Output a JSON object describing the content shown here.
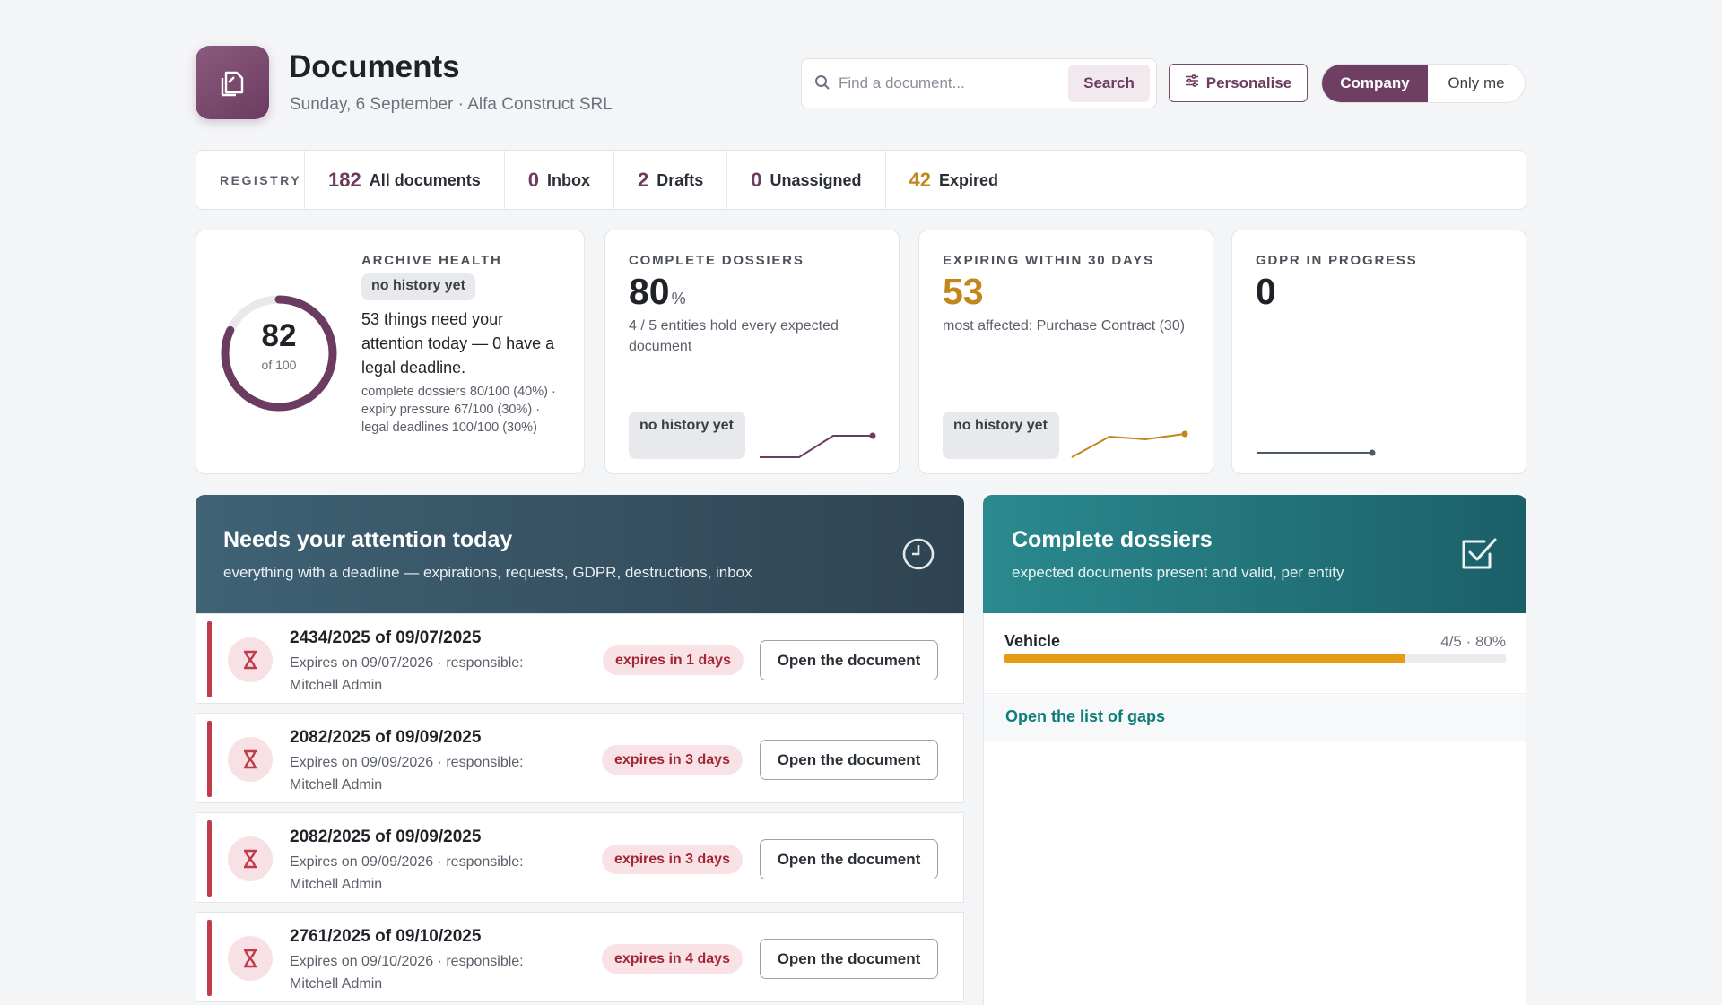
{
  "header": {
    "title": "Documents",
    "subtitle": "Sunday, 6 September · Alfa Construct SRL",
    "search_placeholder": "Find a document...",
    "search_button": "Search",
    "personalise_button": "Personalise",
    "scope_options": [
      "Company",
      "Only me"
    ],
    "scope_selected": "Company"
  },
  "registry": {
    "label": "REGISTRY",
    "items": [
      {
        "count": "182",
        "label": "All documents"
      },
      {
        "count": "0",
        "label": "Inbox"
      },
      {
        "count": "2",
        "label": "Drafts"
      },
      {
        "count": "0",
        "label": "Unassigned"
      },
      {
        "count": "42",
        "label": "Expired"
      }
    ]
  },
  "archive_health": {
    "label": "ARCHIVE HEALTH",
    "badge": "no history yet",
    "score": "82",
    "score_max_label": "of 100",
    "score_fraction": 0.82,
    "headline": "53 things need your attention today — 0 have a legal deadline.",
    "breakdown": "complete dossiers 80/100 (40%) · expiry pressure 67/100 (30%) · legal deadlines 100/100 (30%)"
  },
  "complete_dossiers_kpi": {
    "label": "COMPLETE DOSSIERS",
    "value": "80",
    "unit": "%",
    "description": "4 / 5 entities hold every expected document",
    "badge": "no history yet",
    "sparkline_color": "#6b3b60"
  },
  "expiring_kpi": {
    "label": "EXPIRING WITHIN 30 DAYS",
    "value": "53",
    "description": "most affected: Purchase Contract (30)",
    "badge": "no history yet",
    "value_color": "#c2861b",
    "sparkline_color": "#c2861b"
  },
  "gdpr_kpi": {
    "label": "GDPR IN PROGRESS",
    "value": "0",
    "sparkline_color": "#4a5a6a"
  },
  "attention": {
    "title": "Needs your attention today",
    "subtitle": "everything with a deadline — expirations, requests, GDPR, destructions, inbox",
    "icon": "clock-icon",
    "rows": [
      {
        "title": "2434/2025 of 09/07/2025",
        "desc": "Expires on 09/07/2026 · responsible: Mitchell Admin",
        "badge": "expires in 1 days",
        "button": "Open the document"
      },
      {
        "title": "2082/2025 of 09/09/2025",
        "desc": "Expires on 09/09/2026 · responsible: Mitchell Admin",
        "badge": "expires in 3 days",
        "button": "Open the document"
      },
      {
        "title": "2082/2025 of 09/09/2025",
        "desc": "Expires on 09/09/2026 · responsible: Mitchell Admin",
        "badge": "expires in 3 days",
        "button": "Open the document"
      },
      {
        "title": "2761/2025 of 09/10/2025",
        "desc": "Expires on 09/10/2026 · responsible: Mitchell Admin",
        "badge": "expires in 4 days",
        "button": "Open the document"
      }
    ]
  },
  "dossiers": {
    "title": "Complete dossiers",
    "subtitle": "expected documents present and valid, per entity",
    "icon": "checkbox-checked-icon",
    "rows": [
      {
        "name": "Vehicle",
        "stat": "4/5 · 80%",
        "progress": 0.8
      }
    ],
    "gaps_link": "Open the list of gaps"
  }
}
